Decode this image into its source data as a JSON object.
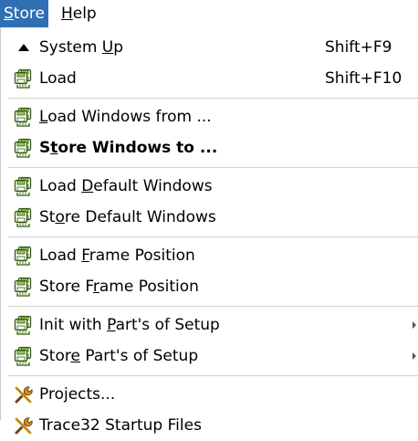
{
  "menubar": {
    "store": {
      "pre": "",
      "acc": "S",
      "post": "tore"
    },
    "help": {
      "pre": "",
      "acc": "H",
      "post": "elp"
    }
  },
  "menu": {
    "system_up": {
      "pre": "System ",
      "acc": "U",
      "post": "p",
      "shortcut": "Shift+F9",
      "icon": "triangle-up-icon"
    },
    "load": {
      "pre": "Load",
      "acc": "",
      "post": "",
      "shortcut": "Shift+F10",
      "icon": "diskette-stack-icon"
    },
    "load_windows_from": {
      "pre": "",
      "acc": "L",
      "post": "oad Windows from ...",
      "icon": "diskette-stack-icon"
    },
    "store_windows_to": {
      "pre": "S",
      "acc": "t",
      "post": "ore Windows to ...",
      "icon": "diskette-stack-icon"
    },
    "load_default_windows": {
      "pre": "Load ",
      "acc": "D",
      "post": "efault Windows",
      "icon": "diskette-stack-icon"
    },
    "store_default_windows": {
      "pre": "St",
      "acc": "o",
      "post": "re Default Windows",
      "icon": "diskette-stack-icon"
    },
    "load_frame_position": {
      "pre": "Load ",
      "acc": "F",
      "post": "rame Position",
      "icon": "diskette-stack-icon"
    },
    "store_frame_position": {
      "pre": "Store F",
      "acc": "r",
      "post": "ame Position",
      "icon": "diskette-stack-icon"
    },
    "init_with_parts": {
      "pre": "Init with ",
      "acc": "P",
      "post": "art's of Setup",
      "icon": "diskette-stack-icon"
    },
    "store_parts": {
      "pre": "Stor",
      "acc": "e",
      "post": " Part's of Setup",
      "icon": "diskette-stack-icon"
    },
    "projects": {
      "pre": "Projects...",
      "acc": "",
      "post": "",
      "icon": "wrench-screwdriver-icon"
    },
    "startup_files": {
      "pre": "Trace32 Startup Files",
      "acc": "",
      "post": "",
      "icon": "wrench-screwdriver-icon"
    }
  },
  "colors": {
    "menubar_highlight": "#2f6fb3",
    "diskette_green": "#4f8a1a",
    "tool_orange": "#d98a1e"
  }
}
